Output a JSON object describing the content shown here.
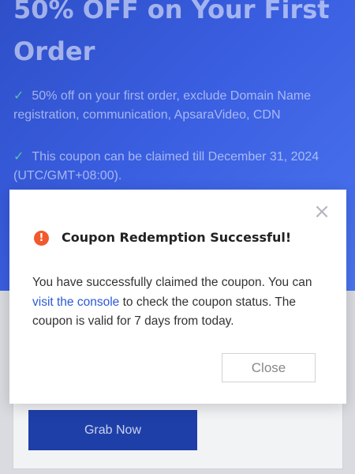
{
  "hero": {
    "title": "50% OFF on Your First Order",
    "benefits": [
      {
        "icon": "check-icon",
        "text": "50% off on your first order, exclude Domain Name registration, communication, ApsaraVideo, CDN"
      },
      {
        "icon": "check-icon",
        "text": "This coupon can be claimed till December 31, 2024 (UTC/GMT+08:00)."
      }
    ]
  },
  "card": {
    "grab_label": "Grab Now"
  },
  "modal": {
    "title": "Coupon Redemption Successful!",
    "status_icon": "alert-circle-icon",
    "body_before": "You have successfully claimed the coupon. You can ",
    "link_text": "visit the console",
    "body_after": " to check the coupon status. The coupon is valid for 7 days from today.",
    "close_label": "Close",
    "close_icon": "close-icon"
  },
  "colors": {
    "hero_gradient_start": "#2e4fc8",
    "hero_gradient_end": "#4a74f0",
    "primary_button": "#1f3fa8",
    "link": "#2a59d6",
    "alert": "#f05a2c",
    "check": "#56d6a6"
  }
}
